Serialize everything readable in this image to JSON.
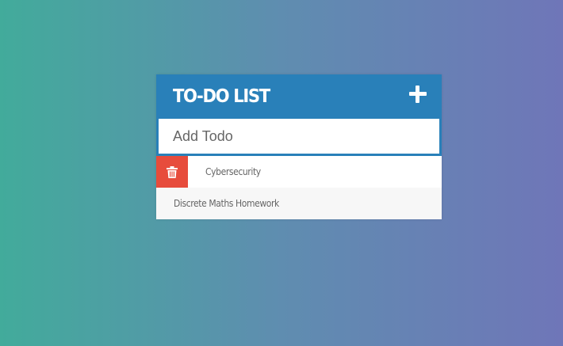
{
  "header": {
    "title": "TO-DO LIST",
    "add_icon": "plus-icon"
  },
  "input": {
    "placeholder": "Add Todo",
    "value": ""
  },
  "todos": [
    {
      "text": "Cybersecurity",
      "delete_visible": true,
      "delete_icon": "trash-icon"
    },
    {
      "text": "Discrete Maths Homework",
      "delete_visible": false
    }
  ],
  "colors": {
    "header_bg": "#2980b9",
    "delete_bg": "#e74c3c",
    "gradient_start": "#42ab9b",
    "gradient_end": "#6f76b8"
  }
}
